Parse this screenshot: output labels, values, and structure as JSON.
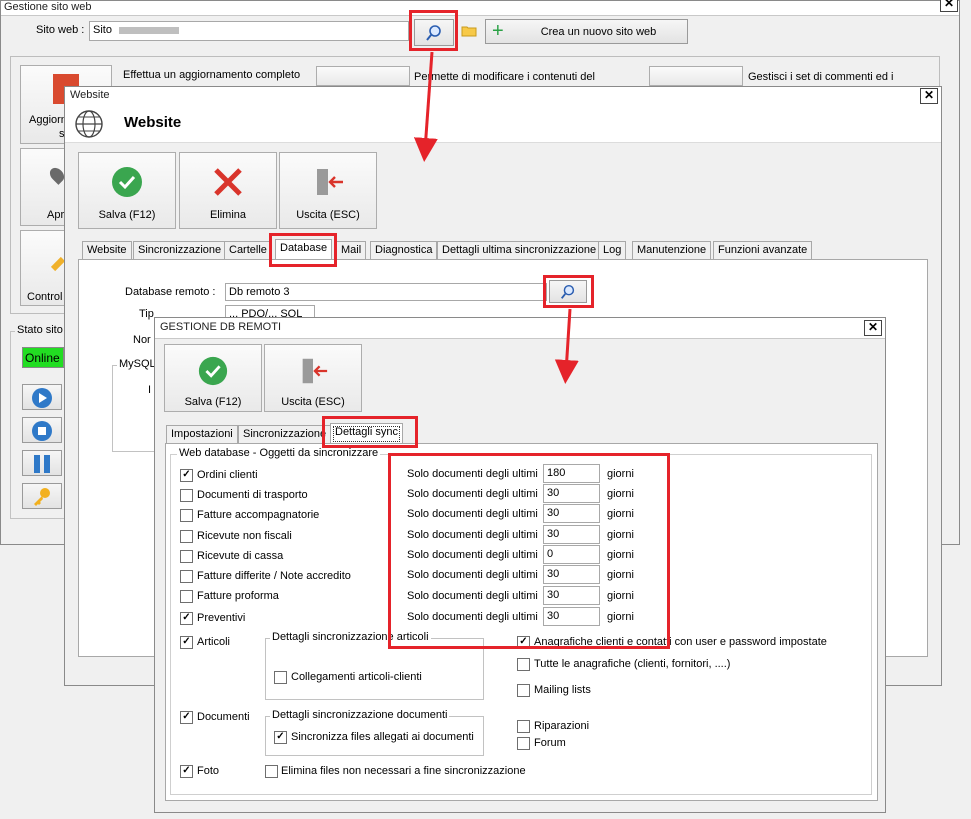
{
  "main": {
    "title": "Gestione sito web",
    "site_label": "Sito web :",
    "site_value": "Sito",
    "new_site_label": "Crea un nuovo sito web",
    "tile1_text": "Effettua un aggiornamento completo",
    "tile2_text": "Permette di modificare i contenuti del",
    "tile3_text": "Gestisci i set di commenti ed i",
    "left_buttons": [
      "Aggiorn",
      "s",
      "Apr",
      "Control"
    ],
    "status_group": "Stato sito",
    "status_value": "Online"
  },
  "website": {
    "title": "Website",
    "heading": "Website",
    "save_label": "Salva (F12)",
    "delete_label": "Elimina",
    "exit_label": "Uscita (ESC)",
    "tabs": [
      "Website",
      "Sincronizzazione",
      "Cartelle",
      "Database",
      "Mail",
      "Diagnostica",
      "Dettagli ultima sincronizzazione",
      "Log",
      "Manutenzione",
      "Funzioni avanzate"
    ],
    "remote_db_label": "Database remoto :",
    "remote_db_value": "Db remoto 3",
    "type_label": "Tip",
    "type_value": "... PDO/... SQL",
    "name_label": "Nor",
    "mysql_label": "MySQL",
    "partial_label": "I"
  },
  "dbremoti": {
    "title": "GESTIONE DB REMOTI",
    "save_label": "Salva (F12)",
    "exit_label": "Uscita (ESC)",
    "tabs": [
      "Impostazioni",
      "Sincronizzazione",
      "Dettagli sync"
    ],
    "group_title": "Web database - Oggetti da sincronizzare",
    "objects": [
      {
        "label": "Ordini clienti",
        "checked": true
      },
      {
        "label": "Documenti di trasporto",
        "checked": false
      },
      {
        "label": "Fatture accompagnatorie",
        "checked": false
      },
      {
        "label": "Ricevute non fiscali",
        "checked": false
      },
      {
        "label": "Ricevute di cassa",
        "checked": false
      },
      {
        "label": "Fatture differite / Note accredito",
        "checked": false
      },
      {
        "label": "Fatture proforma",
        "checked": false
      },
      {
        "label": "Preventivi",
        "checked": true
      }
    ],
    "days_prefix": "Solo documenti degli ultimi",
    "days_suffix": "giorni",
    "days": [
      "180",
      "30",
      "30",
      "30",
      "0",
      "30",
      "30",
      "30"
    ],
    "articoli_label": "Articoli",
    "articoli_group": "Dettagli sincronizzazione articoli",
    "collegamenti_label": "Collegamenti articoli-clienti",
    "documenti_label": "Documenti",
    "documenti_group": "Dettagli sincronizzazione documenti",
    "sync_files_label": "Sincronizza files allegati ai documenti",
    "foto_label": "Foto",
    "elimina_files_label": "Elimina files non necessari a fine sincronizzazione",
    "anag_user_label": "Anagrafiche clienti e contatti con user e password impostate",
    "anag_all_label": "Tutte le anagrafiche (clienti, fornitori, ....)",
    "mailing_label": "Mailing lists",
    "riparazioni_label": "Riparazioni",
    "forum_label": "Forum"
  },
  "colors": {
    "highlight": "#e5232a",
    "online": "#22dd22",
    "check_green": "#3aa64f",
    "x_red": "#d9342b"
  }
}
